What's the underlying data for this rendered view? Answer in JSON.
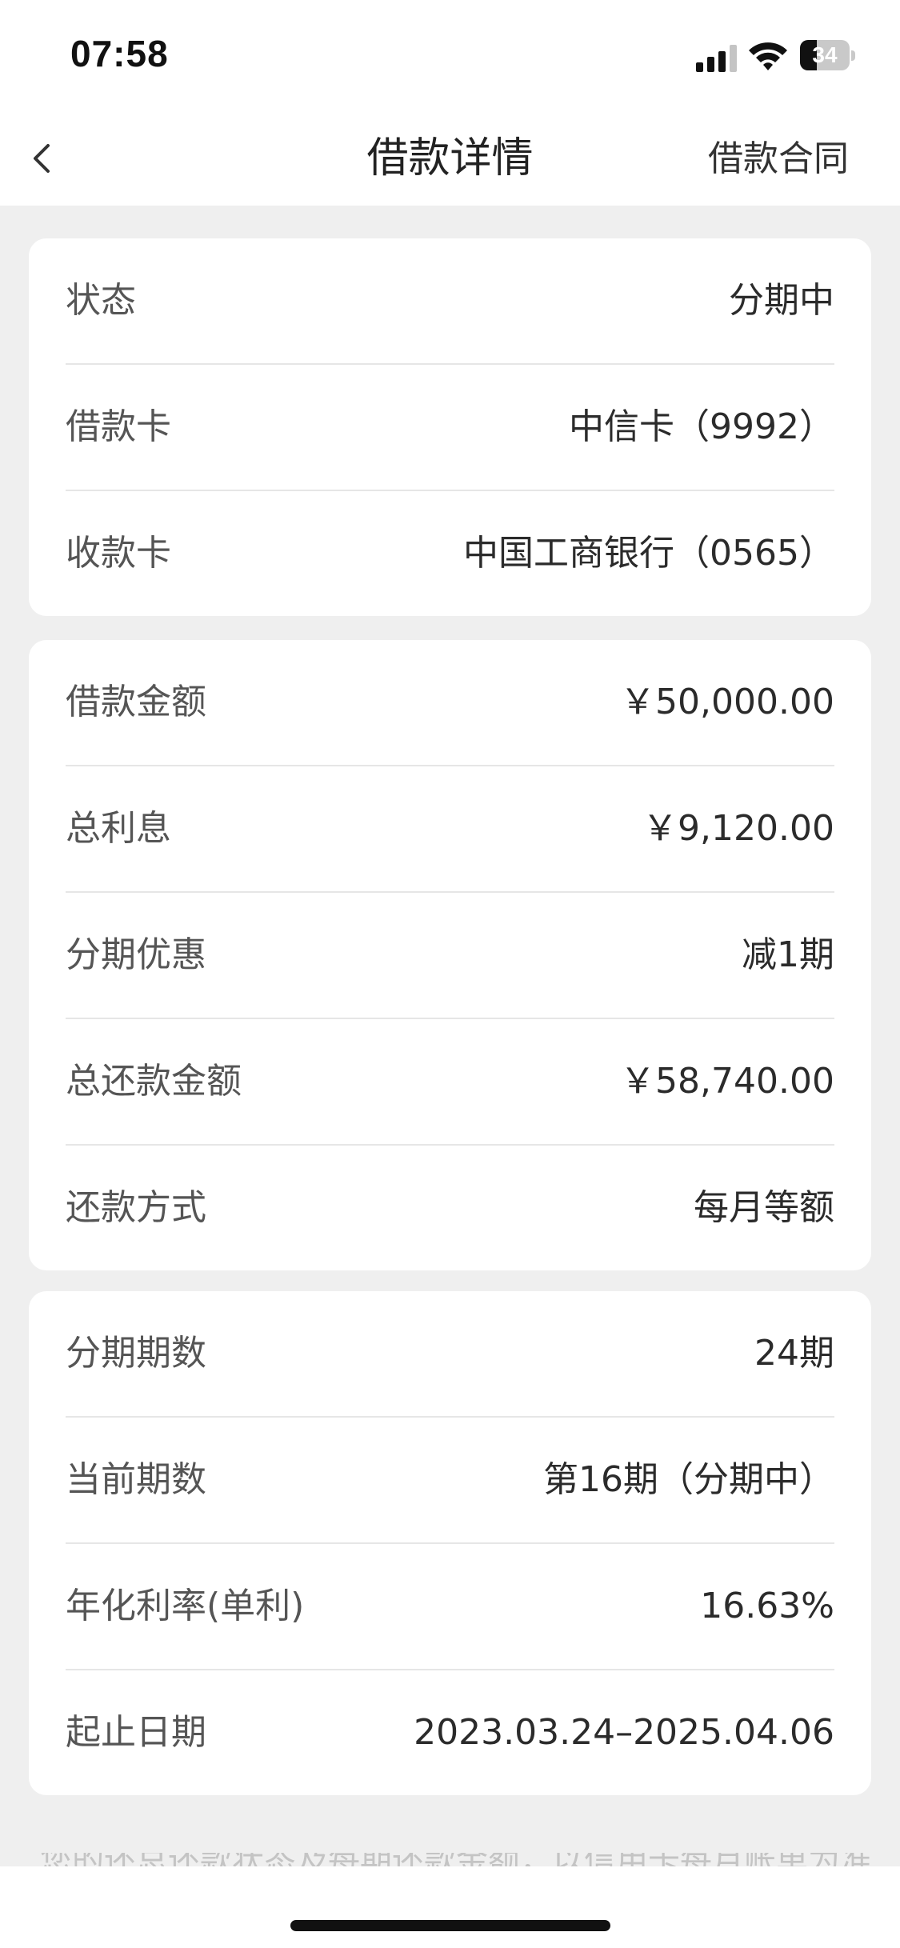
{
  "status_bar": {
    "time": "07:58",
    "battery": "34",
    "battery_level": 0.34
  },
  "header": {
    "title": "借款详情",
    "right_link": "借款合同"
  },
  "section1": [
    {
      "label": "状态",
      "value": "分期中"
    },
    {
      "label": "借款卡",
      "value": "中信卡（9992）"
    },
    {
      "label": "收款卡",
      "value": "中国工商银行（0565）"
    }
  ],
  "section2": [
    {
      "label": "借款金额",
      "value": "￥50,000.00"
    },
    {
      "label": "总利息",
      "value": "￥9,120.00"
    },
    {
      "label": "分期优惠",
      "value": "减1期"
    },
    {
      "label": "总还款金额",
      "value": "￥58,740.00"
    },
    {
      "label": "还款方式",
      "value": "每月等额"
    }
  ],
  "section3": [
    {
      "label": "分期期数",
      "value": "24期"
    },
    {
      "label": "当前期数",
      "value": "第16期（分期中）"
    },
    {
      "label": "年化利率(单利)",
      "value": "16.63%"
    },
    {
      "label": "起止日期",
      "value": "2023.03.24–2025.04.06"
    }
  ],
  "footer_note": "您的还总还款状态及每期还款金额，以信用卡每月账单为准"
}
